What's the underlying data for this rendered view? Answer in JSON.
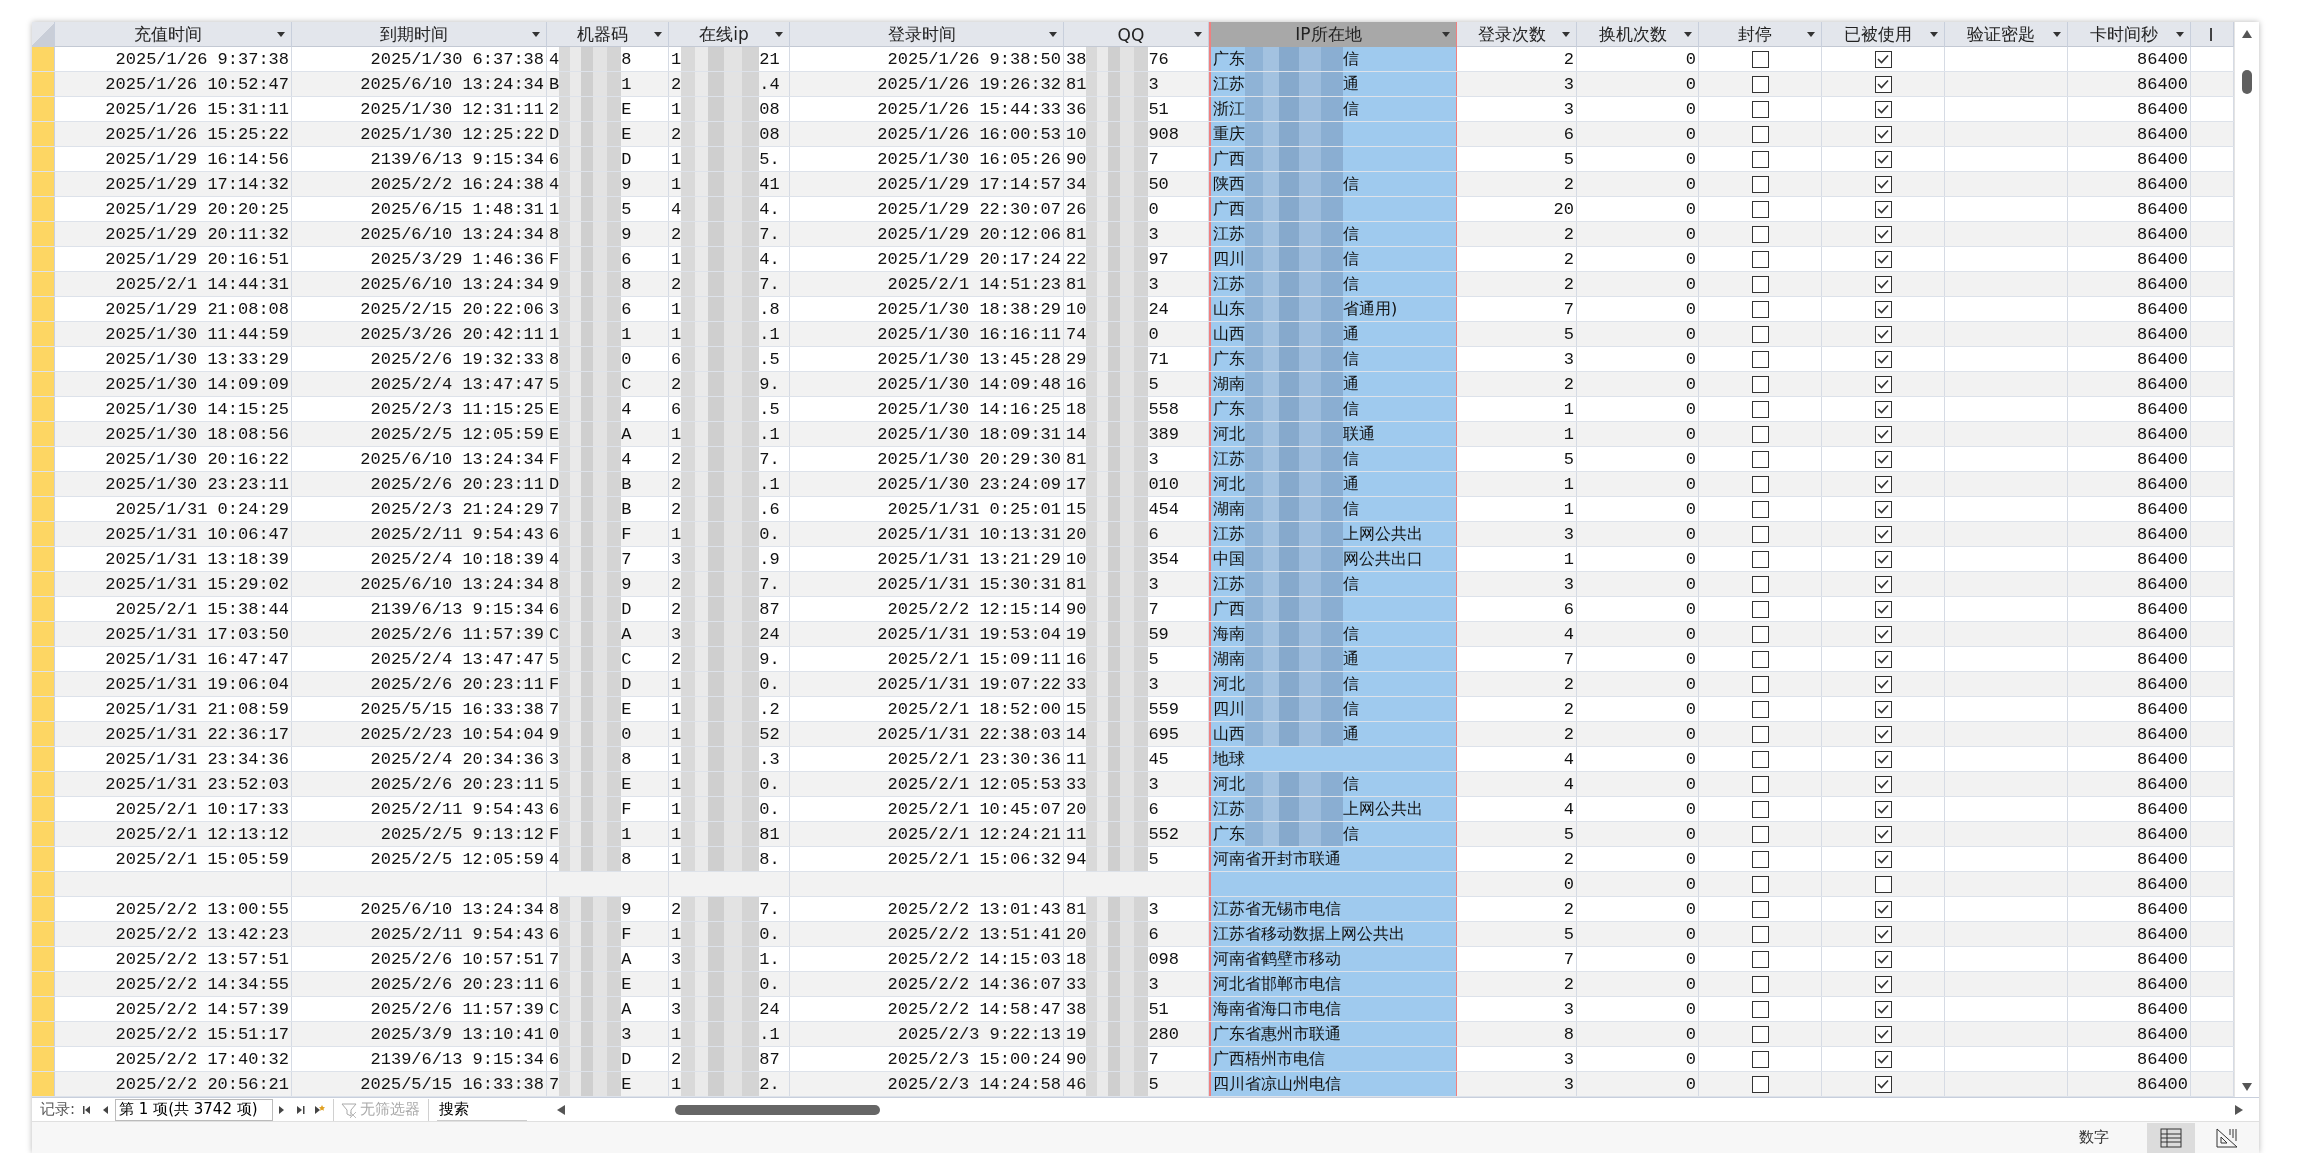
{
  "columns": [
    {
      "label": "充值时间",
      "kind": "date",
      "selected": false
    },
    {
      "label": "到期时间",
      "kind": "date",
      "selected": false
    },
    {
      "label": "机器码",
      "kind": "split",
      "selected": false
    },
    {
      "label": "在线ip",
      "kind": "split",
      "selected": false
    },
    {
      "label": "登录时间",
      "kind": "date",
      "selected": false
    },
    {
      "label": "QQ",
      "kind": "split",
      "selected": false
    },
    {
      "label": "IP所在地",
      "kind": "location",
      "selected": true
    },
    {
      "label": "登录次数",
      "kind": "number",
      "selected": false
    },
    {
      "label": "换机次数",
      "kind": "number",
      "selected": false
    },
    {
      "label": "封停",
      "kind": "check",
      "selected": false
    },
    {
      "label": "已被使用",
      "kind": "check",
      "selected": false
    },
    {
      "label": "验证密匙",
      "kind": "text",
      "selected": false
    },
    {
      "label": "卡时间秒",
      "kind": "number",
      "selected": false
    },
    {
      "label": "I",
      "kind": "text",
      "selected": false
    }
  ],
  "rows": [
    {
      "cells": [
        {
          "text": "2025/1/26 9:37:38"
        },
        {
          "text": "2025/1/30 6:37:38"
        },
        {
          "start": "4",
          "end": "8"
        },
        {
          "start": "1",
          "end": "21"
        },
        {
          "text": "2025/1/26 9:38:50"
        },
        {
          "start": "38",
          "end": "76"
        },
        {
          "start": "广东",
          "end": "信"
        },
        {
          "text": "2"
        },
        {
          "text": "0"
        },
        {
          "checked": false
        },
        {
          "checked": true
        },
        {},
        {
          "text": "86400"
        }
      ]
    },
    {
      "cells": [
        {
          "text": "2025/1/26 10:52:47"
        },
        {
          "text": "2025/6/10 13:24:34"
        },
        {
          "start": "B",
          "end": "1"
        },
        {
          "start": "2",
          "end": ".4"
        },
        {
          "text": "2025/1/26 19:26:32"
        },
        {
          "start": "81",
          "end": "3"
        },
        {
          "start": "江苏",
          "end": "通"
        },
        {
          "text": "3"
        },
        {
          "text": "0"
        },
        {
          "checked": false
        },
        {
          "checked": true
        },
        {},
        {
          "text": "86400"
        }
      ]
    },
    {
      "cells": [
        {
          "text": "2025/1/26 15:31:11"
        },
        {
          "text": "2025/1/30 12:31:11"
        },
        {
          "start": "2",
          "end": "E"
        },
        {
          "start": "1",
          "end": "08"
        },
        {
          "text": "2025/1/26 15:44:33"
        },
        {
          "start": "36",
          "end": "51"
        },
        {
          "start": "浙江",
          "end": "信"
        },
        {
          "text": "3"
        },
        {
          "text": "0"
        },
        {
          "checked": false
        },
        {
          "checked": true
        },
        {},
        {
          "text": "86400"
        }
      ]
    },
    {
      "cells": [
        {
          "text": "2025/1/26 15:25:22"
        },
        {
          "text": "2025/1/30 12:25:22"
        },
        {
          "start": "D",
          "end": "E"
        },
        {
          "start": "2",
          "end": "08"
        },
        {
          "text": "2025/1/26 16:00:53"
        },
        {
          "start": "10",
          "end": "908"
        },
        {
          "start": "重庆"
        },
        {
          "text": "6"
        },
        {
          "text": "0"
        },
        {
          "checked": false
        },
        {
          "checked": true
        },
        {},
        {
          "text": "86400"
        }
      ]
    },
    {
      "cells": [
        {
          "text": "2025/1/29 16:14:56"
        },
        {
          "text": "2139/6/13 9:15:34"
        },
        {
          "start": "6",
          "end": "D"
        },
        {
          "start": "1",
          "end": "5."
        },
        {
          "text": "2025/1/30 16:05:26"
        },
        {
          "start": "90",
          "end": "7"
        },
        {
          "start": "广西"
        },
        {
          "text": "5"
        },
        {
          "text": "0"
        },
        {
          "checked": false
        },
        {
          "checked": true
        },
        {},
        {
          "text": "86400"
        }
      ]
    },
    {
      "cells": [
        {
          "text": "2025/1/29 17:14:32"
        },
        {
          "text": "2025/2/2 16:24:38"
        },
        {
          "start": "4",
          "end": "9"
        },
        {
          "start": "1",
          "end": "41"
        },
        {
          "text": "2025/1/29 17:14:57"
        },
        {
          "start": "34",
          "end": "50"
        },
        {
          "start": "陕西",
          "end": "信"
        },
        {
          "text": "2"
        },
        {
          "text": "0"
        },
        {
          "checked": false
        },
        {
          "checked": true
        },
        {},
        {
          "text": "86400"
        }
      ]
    },
    {
      "cells": [
        {
          "text": "2025/1/29 20:20:25"
        },
        {
          "text": "2025/6/15 1:48:31"
        },
        {
          "start": "1",
          "end": "5"
        },
        {
          "start": "4",
          "end": "4."
        },
        {
          "text": "2025/1/29 22:30:07"
        },
        {
          "start": "26",
          "end": "0"
        },
        {
          "start": "广西"
        },
        {
          "text": "20"
        },
        {
          "text": "0"
        },
        {
          "checked": false
        },
        {
          "checked": true
        },
        {},
        {
          "text": "86400"
        }
      ]
    },
    {
      "cells": [
        {
          "text": "2025/1/29 20:11:32"
        },
        {
          "text": "2025/6/10 13:24:34"
        },
        {
          "start": "8",
          "end": "9"
        },
        {
          "start": "2",
          "end": "7."
        },
        {
          "text": "2025/1/29 20:12:06"
        },
        {
          "start": "81",
          "end": "3"
        },
        {
          "start": "江苏",
          "end": "信"
        },
        {
          "text": "2"
        },
        {
          "text": "0"
        },
        {
          "checked": false
        },
        {
          "checked": true
        },
        {},
        {
          "text": "86400"
        }
      ]
    },
    {
      "cells": [
        {
          "text": "2025/1/29 20:16:51"
        },
        {
          "text": "2025/3/29 1:46:36"
        },
        {
          "start": "F",
          "end": "6"
        },
        {
          "start": "1",
          "end": "4."
        },
        {
          "text": "2025/1/29 20:17:24"
        },
        {
          "start": "22",
          "end": "97"
        },
        {
          "start": "四川",
          "end": "信"
        },
        {
          "text": "2"
        },
        {
          "text": "0"
        },
        {
          "checked": false
        },
        {
          "checked": true
        },
        {},
        {
          "text": "86400"
        }
      ]
    },
    {
      "cells": [
        {
          "text": "2025/2/1 14:44:31"
        },
        {
          "text": "2025/6/10 13:24:34"
        },
        {
          "start": "9",
          "end": "8"
        },
        {
          "start": "2",
          "end": "7."
        },
        {
          "text": "2025/2/1 14:51:23"
        },
        {
          "start": "81",
          "end": "3"
        },
        {
          "start": "江苏",
          "end": "信"
        },
        {
          "text": "2"
        },
        {
          "text": "0"
        },
        {
          "checked": false
        },
        {
          "checked": true
        },
        {},
        {
          "text": "86400"
        }
      ]
    },
    {
      "cells": [
        {
          "text": "2025/1/29 21:08:08"
        },
        {
          "text": "2025/2/15 20:22:06"
        },
        {
          "start": "3",
          "end": "6"
        },
        {
          "start": "1",
          "end": ".8"
        },
        {
          "text": "2025/1/30 18:38:29"
        },
        {
          "start": "10",
          "end": "24"
        },
        {
          "start": "山东",
          "end": "省通用)"
        },
        {
          "text": "7"
        },
        {
          "text": "0"
        },
        {
          "checked": false
        },
        {
          "checked": true
        },
        {},
        {
          "text": "86400"
        }
      ]
    },
    {
      "cells": [
        {
          "text": "2025/1/30 11:44:59"
        },
        {
          "text": "2025/3/26 20:42:11"
        },
        {
          "start": "1",
          "end": "1"
        },
        {
          "start": "1",
          "end": ".1"
        },
        {
          "text": "2025/1/30 16:16:11"
        },
        {
          "start": "74",
          "end": "0"
        },
        {
          "start": "山西",
          "end": "通"
        },
        {
          "text": "5"
        },
        {
          "text": "0"
        },
        {
          "checked": false
        },
        {
          "checked": true
        },
        {},
        {
          "text": "86400"
        }
      ]
    },
    {
      "cells": [
        {
          "text": "2025/1/30 13:33:29"
        },
        {
          "text": "2025/2/6 19:32:33"
        },
        {
          "start": "8",
          "end": "0"
        },
        {
          "start": "6",
          "end": ".5"
        },
        {
          "text": "2025/1/30 13:45:28"
        },
        {
          "start": "29",
          "end": "71"
        },
        {
          "start": "广东",
          "end": "信"
        },
        {
          "text": "3"
        },
        {
          "text": "0"
        },
        {
          "checked": false
        },
        {
          "checked": true
        },
        {},
        {
          "text": "86400"
        }
      ]
    },
    {
      "cells": [
        {
          "text": "2025/1/30 14:09:09"
        },
        {
          "text": "2025/2/4 13:47:47"
        },
        {
          "start": "5",
          "end": "C"
        },
        {
          "start": "2",
          "end": "9."
        },
        {
          "text": "2025/1/30 14:09:48"
        },
        {
          "start": "16",
          "end": "5"
        },
        {
          "start": "湖南",
          "end": "通"
        },
        {
          "text": "2"
        },
        {
          "text": "0"
        },
        {
          "checked": false
        },
        {
          "checked": true
        },
        {},
        {
          "text": "86400"
        }
      ]
    },
    {
      "cells": [
        {
          "text": "2025/1/30 14:15:25"
        },
        {
          "text": "2025/2/3 11:15:25"
        },
        {
          "start": "E",
          "end": "4"
        },
        {
          "start": "6",
          "end": ".5"
        },
        {
          "text": "2025/1/30 14:16:25"
        },
        {
          "start": "18",
          "end": "558"
        },
        {
          "start": "广东",
          "end": "信"
        },
        {
          "text": "1"
        },
        {
          "text": "0"
        },
        {
          "checked": false
        },
        {
          "checked": true
        },
        {},
        {
          "text": "86400"
        }
      ]
    },
    {
      "cells": [
        {
          "text": "2025/1/30 18:08:56"
        },
        {
          "text": "2025/2/5 12:05:59"
        },
        {
          "start": "E",
          "end": "A"
        },
        {
          "start": "1",
          "end": ".1"
        },
        {
          "text": "2025/1/30 18:09:31"
        },
        {
          "start": "14",
          "end": "389"
        },
        {
          "start": "河北",
          "end": "联通"
        },
        {
          "text": "1"
        },
        {
          "text": "0"
        },
        {
          "checked": false
        },
        {
          "checked": true
        },
        {},
        {
          "text": "86400"
        }
      ]
    },
    {
      "cells": [
        {
          "text": "2025/1/30 20:16:22"
        },
        {
          "text": "2025/6/10 13:24:34"
        },
        {
          "start": "F",
          "end": "4"
        },
        {
          "start": "2",
          "end": "7."
        },
        {
          "text": "2025/1/30 20:29:30"
        },
        {
          "start": "81",
          "end": "3"
        },
        {
          "start": "江苏",
          "end": "信"
        },
        {
          "text": "5"
        },
        {
          "text": "0"
        },
        {
          "checked": false
        },
        {
          "checked": true
        },
        {},
        {
          "text": "86400"
        }
      ]
    },
    {
      "cells": [
        {
          "text": "2025/1/30 23:23:11"
        },
        {
          "text": "2025/2/6 20:23:11"
        },
        {
          "start": "D",
          "end": "B"
        },
        {
          "start": "2",
          "end": ".1"
        },
        {
          "text": "2025/1/30 23:24:09"
        },
        {
          "start": "17",
          "end": "010"
        },
        {
          "start": "河北",
          "end": "通"
        },
        {
          "text": "1"
        },
        {
          "text": "0"
        },
        {
          "checked": false
        },
        {
          "checked": true
        },
        {},
        {
          "text": "86400"
        }
      ]
    },
    {
      "cells": [
        {
          "text": "2025/1/31 0:24:29"
        },
        {
          "text": "2025/2/3 21:24:29"
        },
        {
          "start": "7",
          "end": "B"
        },
        {
          "start": "2",
          "end": ".6"
        },
        {
          "text": "2025/1/31 0:25:01"
        },
        {
          "start": "15",
          "end": "454"
        },
        {
          "start": "湖南",
          "end": "信"
        },
        {
          "text": "1"
        },
        {
          "text": "0"
        },
        {
          "checked": false
        },
        {
          "checked": true
        },
        {},
        {
          "text": "86400"
        }
      ]
    },
    {
      "cells": [
        {
          "text": "2025/1/31 10:06:47"
        },
        {
          "text": "2025/2/11 9:54:43"
        },
        {
          "start": "6",
          "end": "F"
        },
        {
          "start": "1",
          "end": "0."
        },
        {
          "text": "2025/1/31 10:13:31"
        },
        {
          "start": "20",
          "end": "6"
        },
        {
          "start": "江苏",
          "end": "上网公共出"
        },
        {
          "text": "3"
        },
        {
          "text": "0"
        },
        {
          "checked": false
        },
        {
          "checked": true
        },
        {},
        {
          "text": "86400"
        }
      ]
    },
    {
      "cells": [
        {
          "text": "2025/1/31 13:18:39"
        },
        {
          "text": "2025/2/4 10:18:39"
        },
        {
          "start": "4",
          "end": "7"
        },
        {
          "start": "3",
          "end": ".9"
        },
        {
          "text": "2025/1/31 13:21:29"
        },
        {
          "start": "10",
          "end": "354"
        },
        {
          "start": "中国",
          "end": "网公共出口"
        },
        {
          "text": "1"
        },
        {
          "text": "0"
        },
        {
          "checked": false
        },
        {
          "checked": true
        },
        {},
        {
          "text": "86400"
        }
      ]
    },
    {
      "cells": [
        {
          "text": "2025/1/31 15:29:02"
        },
        {
          "text": "2025/6/10 13:24:34"
        },
        {
          "start": "8",
          "end": "9"
        },
        {
          "start": "2",
          "end": "7."
        },
        {
          "text": "2025/1/31 15:30:31"
        },
        {
          "start": "81",
          "end": "3"
        },
        {
          "start": "江苏",
          "end": "信"
        },
        {
          "text": "3"
        },
        {
          "text": "0"
        },
        {
          "checked": false
        },
        {
          "checked": true
        },
        {},
        {
          "text": "86400"
        }
      ]
    },
    {
      "cells": [
        {
          "text": "2025/2/1 15:38:44"
        },
        {
          "text": "2139/6/13 9:15:34"
        },
        {
          "start": "6",
          "end": "D"
        },
        {
          "start": "2",
          "end": "87"
        },
        {
          "text": "2025/2/2 12:15:14"
        },
        {
          "start": "90",
          "end": "7"
        },
        {
          "start": "广西"
        },
        {
          "text": "6"
        },
        {
          "text": "0"
        },
        {
          "checked": false
        },
        {
          "checked": true
        },
        {},
        {
          "text": "86400"
        }
      ]
    },
    {
      "cells": [
        {
          "text": "2025/1/31 17:03:50"
        },
        {
          "text": "2025/2/6 11:57:39"
        },
        {
          "start": "C",
          "end": "A"
        },
        {
          "start": "3",
          "end": "24"
        },
        {
          "text": "2025/1/31 19:53:04"
        },
        {
          "start": "19",
          "end": "59"
        },
        {
          "start": "海南",
          "end": "信"
        },
        {
          "text": "4"
        },
        {
          "text": "0"
        },
        {
          "checked": false
        },
        {
          "checked": true
        },
        {},
        {
          "text": "86400"
        }
      ]
    },
    {
      "cells": [
        {
          "text": "2025/1/31 16:47:47"
        },
        {
          "text": "2025/2/4 13:47:47"
        },
        {
          "start": "5",
          "end": "C"
        },
        {
          "start": "2",
          "end": "9."
        },
        {
          "text": "2025/2/1 15:09:11"
        },
        {
          "start": "16",
          "end": "5"
        },
        {
          "start": "湖南",
          "end": "通"
        },
        {
          "text": "7"
        },
        {
          "text": "0"
        },
        {
          "checked": false
        },
        {
          "checked": true
        },
        {},
        {
          "text": "86400"
        }
      ]
    },
    {
      "cells": [
        {
          "text": "2025/1/31 19:06:04"
        },
        {
          "text": "2025/2/6 20:23:11"
        },
        {
          "start": "F",
          "end": "D"
        },
        {
          "start": "1",
          "end": "0."
        },
        {
          "text": "2025/1/31 19:07:22"
        },
        {
          "start": "33",
          "end": "3"
        },
        {
          "start": "河北",
          "end": "信"
        },
        {
          "text": "2"
        },
        {
          "text": "0"
        },
        {
          "checked": false
        },
        {
          "checked": true
        },
        {},
        {
          "text": "86400"
        }
      ]
    },
    {
      "cells": [
        {
          "text": "2025/1/31 21:08:59"
        },
        {
          "text": "2025/5/15 16:33:38"
        },
        {
          "start": "7",
          "end": "E"
        },
        {
          "start": "1",
          "end": ".2"
        },
        {
          "text": "2025/2/1 18:52:00"
        },
        {
          "start": "15",
          "end": "559"
        },
        {
          "start": "四川",
          "end": "信"
        },
        {
          "text": "2"
        },
        {
          "text": "0"
        },
        {
          "checked": false
        },
        {
          "checked": true
        },
        {},
        {
          "text": "86400"
        }
      ]
    },
    {
      "cells": [
        {
          "text": "2025/1/31 22:36:17"
        },
        {
          "text": "2025/2/23 10:54:04"
        },
        {
          "start": "9",
          "end": "0"
        },
        {
          "start": "1",
          "end": "52"
        },
        {
          "text": "2025/1/31 22:38:03"
        },
        {
          "start": "14",
          "end": "695"
        },
        {
          "start": "山西",
          "end": "通"
        },
        {
          "text": "2"
        },
        {
          "text": "0"
        },
        {
          "checked": false
        },
        {
          "checked": true
        },
        {},
        {
          "text": "86400"
        }
      ]
    },
    {
      "cells": [
        {
          "text": "2025/1/31 23:34:36"
        },
        {
          "text": "2025/2/4 20:34:36"
        },
        {
          "start": "3",
          "end": "8"
        },
        {
          "start": "1",
          "end": ".3"
        },
        {
          "text": "2025/2/1 23:30:36"
        },
        {
          "start": "11",
          "end": "45"
        },
        {
          "text": "地球"
        },
        {
          "text": "4"
        },
        {
          "text": "0"
        },
        {
          "checked": false
        },
        {
          "checked": true
        },
        {},
        {
          "text": "86400"
        }
      ]
    },
    {
      "cells": [
        {
          "text": "2025/1/31 23:52:03"
        },
        {
          "text": "2025/2/6 20:23:11"
        },
        {
          "start": "5",
          "end": "E"
        },
        {
          "start": "1",
          "end": "0."
        },
        {
          "text": "2025/2/1 12:05:53"
        },
        {
          "start": "33",
          "end": "3"
        },
        {
          "start": "河北",
          "end": "信"
        },
        {
          "text": "4"
        },
        {
          "text": "0"
        },
        {
          "checked": false
        },
        {
          "checked": true
        },
        {},
        {
          "text": "86400"
        }
      ]
    },
    {
      "cells": [
        {
          "text": "2025/2/1 10:17:33"
        },
        {
          "text": "2025/2/11 9:54:43"
        },
        {
          "start": "6",
          "end": "F"
        },
        {
          "start": "1",
          "end": "0."
        },
        {
          "text": "2025/2/1 10:45:07"
        },
        {
          "start": "20",
          "end": "6"
        },
        {
          "start": "江苏",
          "end": "上网公共出"
        },
        {
          "text": "4"
        },
        {
          "text": "0"
        },
        {
          "checked": false
        },
        {
          "checked": true
        },
        {},
        {
          "text": "86400"
        }
      ]
    },
    {
      "cells": [
        {
          "text": "2025/2/1 12:13:12"
        },
        {
          "text": "2025/2/5 9:13:12"
        },
        {
          "start": "F",
          "end": "1"
        },
        {
          "start": "1",
          "end": "81"
        },
        {
          "text": "2025/2/1 12:24:21"
        },
        {
          "start": "11",
          "end": "552"
        },
        {
          "start": "广东",
          "end": "信"
        },
        {
          "text": "5"
        },
        {
          "text": "0"
        },
        {
          "checked": false
        },
        {
          "checked": true
        },
        {},
        {
          "text": "86400"
        }
      ]
    },
    {
      "cells": [
        {
          "text": "2025/2/1 15:05:59"
        },
        {
          "text": "2025/2/5 12:05:59"
        },
        {
          "start": "4",
          "end": "8"
        },
        {
          "start": "1",
          "end": "8."
        },
        {
          "text": "2025/2/1 15:06:32"
        },
        {
          "start": "94",
          "end": "5"
        },
        {
          "text": "河南省开封市联通"
        },
        {
          "text": "2"
        },
        {
          "text": "0"
        },
        {
          "checked": false
        },
        {
          "checked": true
        },
        {},
        {
          "text": "86400"
        }
      ]
    },
    {
      "cells": [
        {},
        {},
        {},
        {},
        {},
        {},
        {},
        {
          "text": "0"
        },
        {
          "text": "0"
        },
        {
          "checked": false
        },
        {
          "checked": false
        },
        {},
        {
          "text": "86400"
        }
      ]
    },
    {
      "cells": [
        {
          "text": "2025/2/2 13:00:55"
        },
        {
          "text": "2025/6/10 13:24:34"
        },
        {
          "start": "8",
          "end": "9"
        },
        {
          "start": "2",
          "end": "7."
        },
        {
          "text": "2025/2/2 13:01:43"
        },
        {
          "start": "81",
          "end": "3"
        },
        {
          "text": "江苏省无锡市电信"
        },
        {
          "text": "2"
        },
        {
          "text": "0"
        },
        {
          "checked": false
        },
        {
          "checked": true
        },
        {},
        {
          "text": "86400"
        }
      ]
    },
    {
      "cells": [
        {
          "text": "2025/2/2 13:42:23"
        },
        {
          "text": "2025/2/11 9:54:43"
        },
        {
          "start": "6",
          "end": "F"
        },
        {
          "start": "1",
          "end": "0."
        },
        {
          "text": "2025/2/2 13:51:41"
        },
        {
          "start": "20",
          "end": "6"
        },
        {
          "text": "江苏省移动数据上网公共出"
        },
        {
          "text": "5"
        },
        {
          "text": "0"
        },
        {
          "checked": false
        },
        {
          "checked": true
        },
        {},
        {
          "text": "86400"
        }
      ]
    },
    {
      "cells": [
        {
          "text": "2025/2/2 13:57:51"
        },
        {
          "text": "2025/2/6 10:57:51"
        },
        {
          "start": "7",
          "end": "A"
        },
        {
          "start": "3",
          "end": "1."
        },
        {
          "text": "2025/2/2 14:15:03"
        },
        {
          "start": "18",
          "end": "098"
        },
        {
          "text": "河南省鹤壁市移动"
        },
        {
          "text": "7"
        },
        {
          "text": "0"
        },
        {
          "checked": false
        },
        {
          "checked": true
        },
        {},
        {
          "text": "86400"
        }
      ]
    },
    {
      "cells": [
        {
          "text": "2025/2/2 14:34:55"
        },
        {
          "text": "2025/2/6 20:23:11"
        },
        {
          "start": "6",
          "end": "E"
        },
        {
          "start": "1",
          "end": "0."
        },
        {
          "text": "2025/2/2 14:36:07"
        },
        {
          "start": "33",
          "end": "3"
        },
        {
          "text": "河北省邯郸市电信"
        },
        {
          "text": "2"
        },
        {
          "text": "0"
        },
        {
          "checked": false
        },
        {
          "checked": true
        },
        {},
        {
          "text": "86400"
        }
      ]
    },
    {
      "cells": [
        {
          "text": "2025/2/2 14:57:39"
        },
        {
          "text": "2025/2/6 11:57:39"
        },
        {
          "start": "C",
          "end": "A"
        },
        {
          "start": "3",
          "end": "24"
        },
        {
          "text": "2025/2/2 14:58:47"
        },
        {
          "start": "38",
          "end": "51"
        },
        {
          "text": "海南省海口市电信"
        },
        {
          "text": "3"
        },
        {
          "text": "0"
        },
        {
          "checked": false
        },
        {
          "checked": true
        },
        {},
        {
          "text": "86400"
        }
      ]
    },
    {
      "cells": [
        {
          "text": "2025/2/2 15:51:17"
        },
        {
          "text": "2025/3/9 13:10:41"
        },
        {
          "start": "0",
          "end": "3"
        },
        {
          "start": "1",
          "end": ".1"
        },
        {
          "text": "2025/2/3 9:22:13"
        },
        {
          "start": "19",
          "end": "280"
        },
        {
          "text": "广东省惠州市联通"
        },
        {
          "text": "8"
        },
        {
          "text": "0"
        },
        {
          "checked": false
        },
        {
          "checked": true
        },
        {},
        {
          "text": "86400"
        }
      ]
    },
    {
      "cells": [
        {
          "text": "2025/2/2 17:40:32"
        },
        {
          "text": "2139/6/13 9:15:34"
        },
        {
          "start": "6",
          "end": "D"
        },
        {
          "start": "2",
          "end": "87"
        },
        {
          "text": "2025/2/3 15:00:24"
        },
        {
          "start": "90",
          "end": "7"
        },
        {
          "text": "广西梧州市电信"
        },
        {
          "text": "3"
        },
        {
          "text": "0"
        },
        {
          "checked": false
        },
        {
          "checked": true
        },
        {},
        {
          "text": "86400"
        }
      ]
    },
    {
      "cells": [
        {
          "text": "2025/2/2 20:56:21"
        },
        {
          "text": "2025/5/15 16:33:38"
        },
        {
          "start": "7",
          "end": "E"
        },
        {
          "start": "1",
          "end": "2."
        },
        {
          "text": "2025/2/3 14:24:58"
        },
        {
          "start": "46",
          "end": "5"
        },
        {
          "text": "四川省凉山州电信"
        },
        {
          "text": "3"
        },
        {
          "text": "0"
        },
        {
          "checked": false
        },
        {
          "checked": true
        },
        {},
        {
          "text": "86400"
        }
      ]
    }
  ],
  "navigator": {
    "label": "记录:",
    "record": "第 1 项(共 3742 项)",
    "filter": {
      "label": "无筛选器",
      "disabled": true
    },
    "search": {
      "placeholder": "搜索"
    }
  },
  "status_bar": {
    "mode": "数字"
  }
}
